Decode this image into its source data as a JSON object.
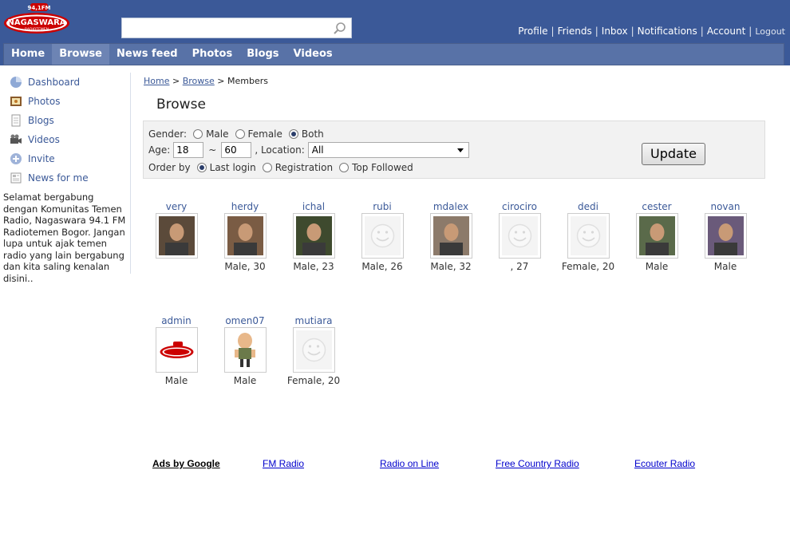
{
  "header": {
    "logo_text": "NAGASWARA",
    "logo_sub": "RADIOTEMEN",
    "logo_freq": "94,1FM",
    "search": {
      "placeholder": ""
    },
    "links": [
      "Profile",
      "Friends",
      "Inbox",
      "Notifications",
      "Account"
    ],
    "logout": "Logout"
  },
  "nav": {
    "items": [
      "Home",
      "Browse",
      "News feed",
      "Photos",
      "Blogs",
      "Videos"
    ],
    "active": "Browse"
  },
  "sidebar": {
    "items": [
      {
        "label": "Dashboard",
        "icon": "dashboard-icon"
      },
      {
        "label": "Photos",
        "icon": "photos-icon"
      },
      {
        "label": "Blogs",
        "icon": "blogs-icon"
      },
      {
        "label": "Videos",
        "icon": "videos-icon"
      },
      {
        "label": "Invite",
        "icon": "invite-icon"
      },
      {
        "label": "News for me",
        "icon": "news-icon"
      }
    ],
    "welcome": "Selamat bergabung dengan Komunitas Temen Radio, Nagaswara 94.1 FM Radiotemen Bogor. Jangan lupa untuk ajak temen radio yang lain bergabung dan kita saling kenalan disini.."
  },
  "breadcrumb": {
    "home": "Home",
    "sep": ">",
    "browse": "Browse",
    "current": "Members"
  },
  "page_title": "Browse",
  "filter": {
    "gender_label": "Gender:",
    "gender_options": [
      "Male",
      "Female",
      "Both"
    ],
    "gender_selected": "Both",
    "age_label": "Age:",
    "age_min": "18",
    "age_sep": "~",
    "age_max": "60",
    "location_label": ", Location:",
    "location_value": "All",
    "order_label": "Order by",
    "order_options": [
      "Last login",
      "Registration",
      "Top Followed"
    ],
    "order_selected": "Last login",
    "update_label": "Update"
  },
  "members": [
    {
      "name": "very",
      "meta": "",
      "avatar": "photo"
    },
    {
      "name": "herdy",
      "meta": "Male, 30",
      "avatar": "photo"
    },
    {
      "name": "ichal",
      "meta": "Male, 23",
      "avatar": "photo"
    },
    {
      "name": "rubi",
      "meta": "Male, 26",
      "avatar": "default"
    },
    {
      "name": "mdalex",
      "meta": "Male, 32",
      "avatar": "photo"
    },
    {
      "name": "cirociro",
      "meta": ", 27",
      "avatar": "default"
    },
    {
      "name": "dedi",
      "meta": "Female, 20",
      "avatar": "default"
    },
    {
      "name": "cester",
      "meta": "Male",
      "avatar": "photo"
    },
    {
      "name": "novan",
      "meta": "Male",
      "avatar": "photo"
    },
    {
      "name": "admin",
      "meta": "Male",
      "avatar": "logo"
    },
    {
      "name": "omen07",
      "meta": "Male",
      "avatar": "cartoon"
    },
    {
      "name": "mutiara",
      "meta": "Female, 20",
      "avatar": "default"
    }
  ],
  "ads": {
    "label": "Ads by Google",
    "links": [
      "FM Radio",
      "Radio on Line",
      "Free Country Radio",
      "Ecouter Radio"
    ]
  },
  "colors": {
    "brand": "#3b5998",
    "nav": "#5872a7",
    "nav_active": "#6d84b4"
  }
}
